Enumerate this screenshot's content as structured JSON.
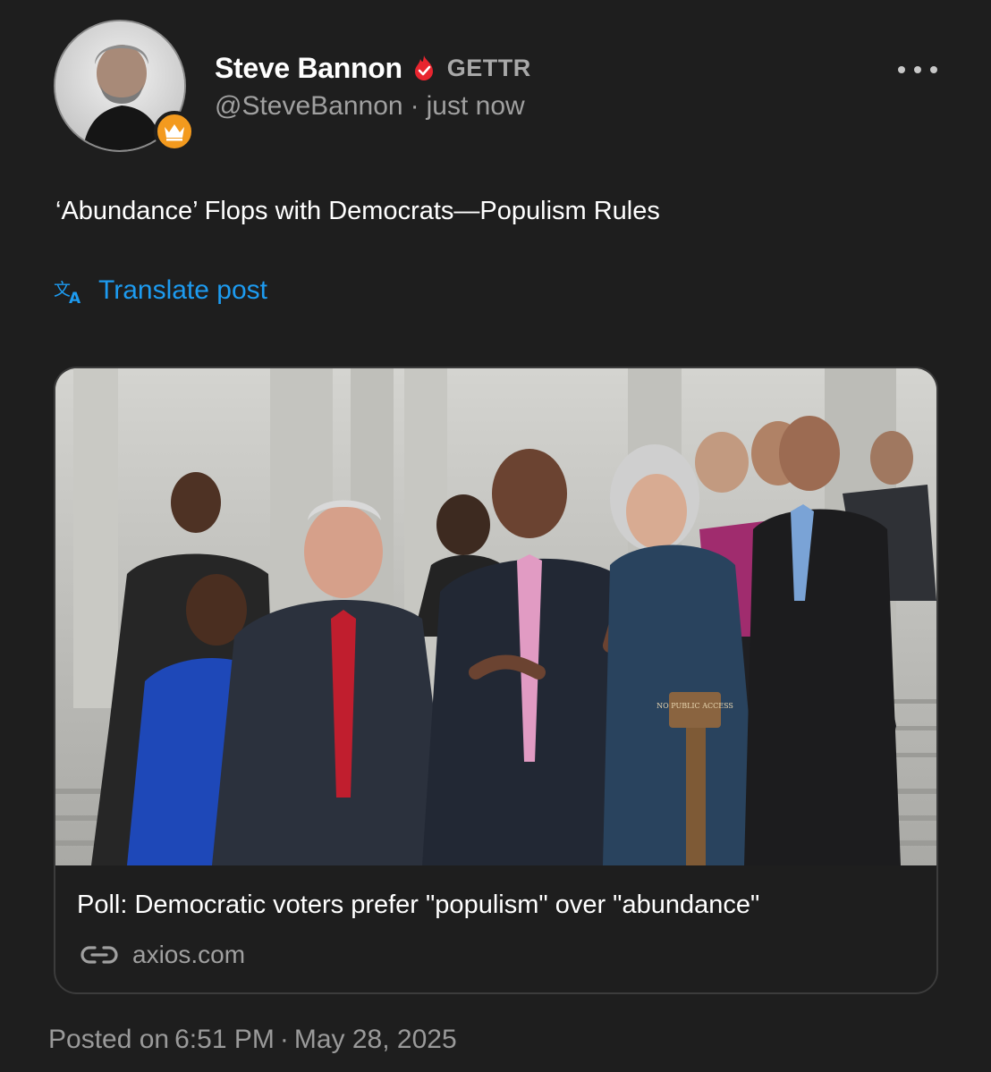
{
  "author": {
    "display_name": "Steve Bannon",
    "platform": "GETTR",
    "handle": "@SteveBannon",
    "separator": "·",
    "relative_time": "just now",
    "badge_icon": "crown-icon",
    "verified_icon": "flame-verified-icon"
  },
  "post": {
    "text": "‘Abundance’ Flops with Democrats—Populism Rules",
    "translate_label": "Translate post"
  },
  "link_card": {
    "title": "Poll: Democratic voters prefer \"populism\" over \"abundance\"",
    "domain": "axios.com",
    "image_sign_text": "NO PUBLIC ACCESS"
  },
  "footer": {
    "posted_prefix": "Posted on",
    "time": "6:51 PM",
    "separator": "·",
    "date": "May 28, 2025"
  },
  "colors": {
    "background": "#1e1e1e",
    "link_blue": "#1d9bf0",
    "verified_red": "#e8252f",
    "crown_orange": "#f39a1e",
    "muted_text": "#a0a0a0"
  }
}
